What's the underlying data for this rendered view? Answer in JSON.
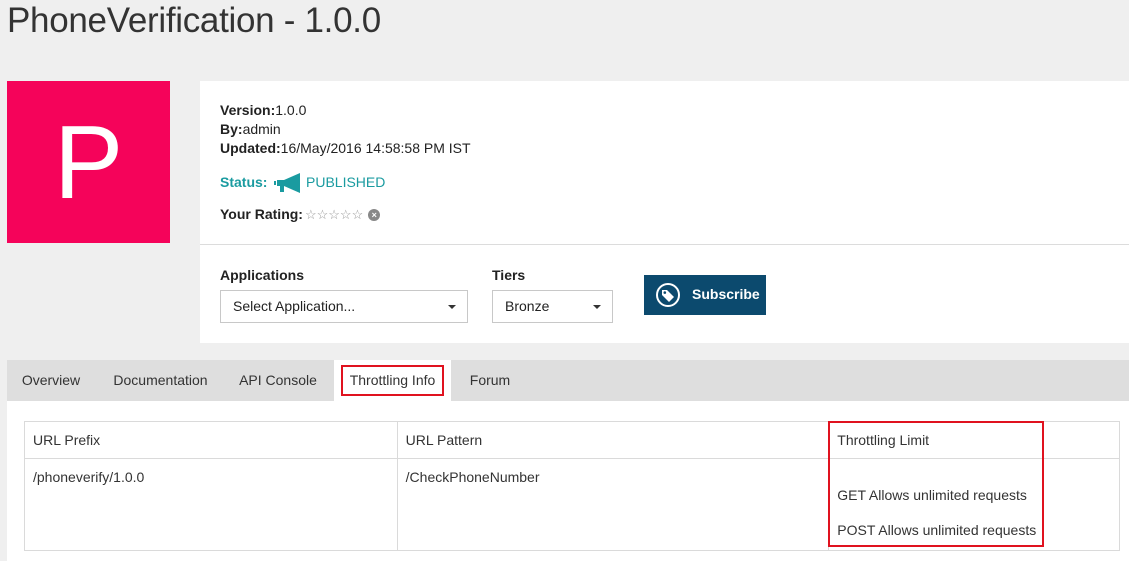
{
  "page": {
    "title": "PhoneVerification - 1.0.0"
  },
  "thumbnail": {
    "letter": "P",
    "color": "#f5035a"
  },
  "info": {
    "version_label": "Version:",
    "version_value": "1.0.0",
    "by_label": "By:",
    "by_value": "admin",
    "updated_label": "Updated:",
    "updated_value": "16/May/2016 14:58:58 PM IST",
    "status_label": "Status:",
    "status_icon": "megaphone-icon",
    "status_value": "PUBLISHED",
    "rating_label": "Your Rating:",
    "rating_stars": "☆☆☆☆☆",
    "rating_value": 0,
    "rating_max": 5,
    "status_color": "#1a9ba0"
  },
  "subscribe": {
    "applications_label": "Applications",
    "application_selected": "Select Application...",
    "tiers_label": "Tiers",
    "tier_selected": "Bronze",
    "button_label": "Subscribe",
    "button_color": "#0c4a6e",
    "button_icon": "tag-icon"
  },
  "tabs": [
    {
      "label": "Overview",
      "active": false
    },
    {
      "label": "Documentation",
      "active": false
    },
    {
      "label": "API Console",
      "active": false
    },
    {
      "label": "Throttling Info",
      "active": true
    },
    {
      "label": "Forum",
      "active": false
    }
  ],
  "table": {
    "headers": [
      "URL Prefix",
      "URL Pattern",
      "Throttling Limit"
    ],
    "rows": [
      {
        "url_prefix": "/phoneverify/1.0.0",
        "url_pattern": "/CheckPhoneNumber",
        "limits": [
          "GET Allows unlimited requests",
          "POST Allows unlimited requests"
        ]
      }
    ]
  },
  "highlight_color": "#e0121f"
}
